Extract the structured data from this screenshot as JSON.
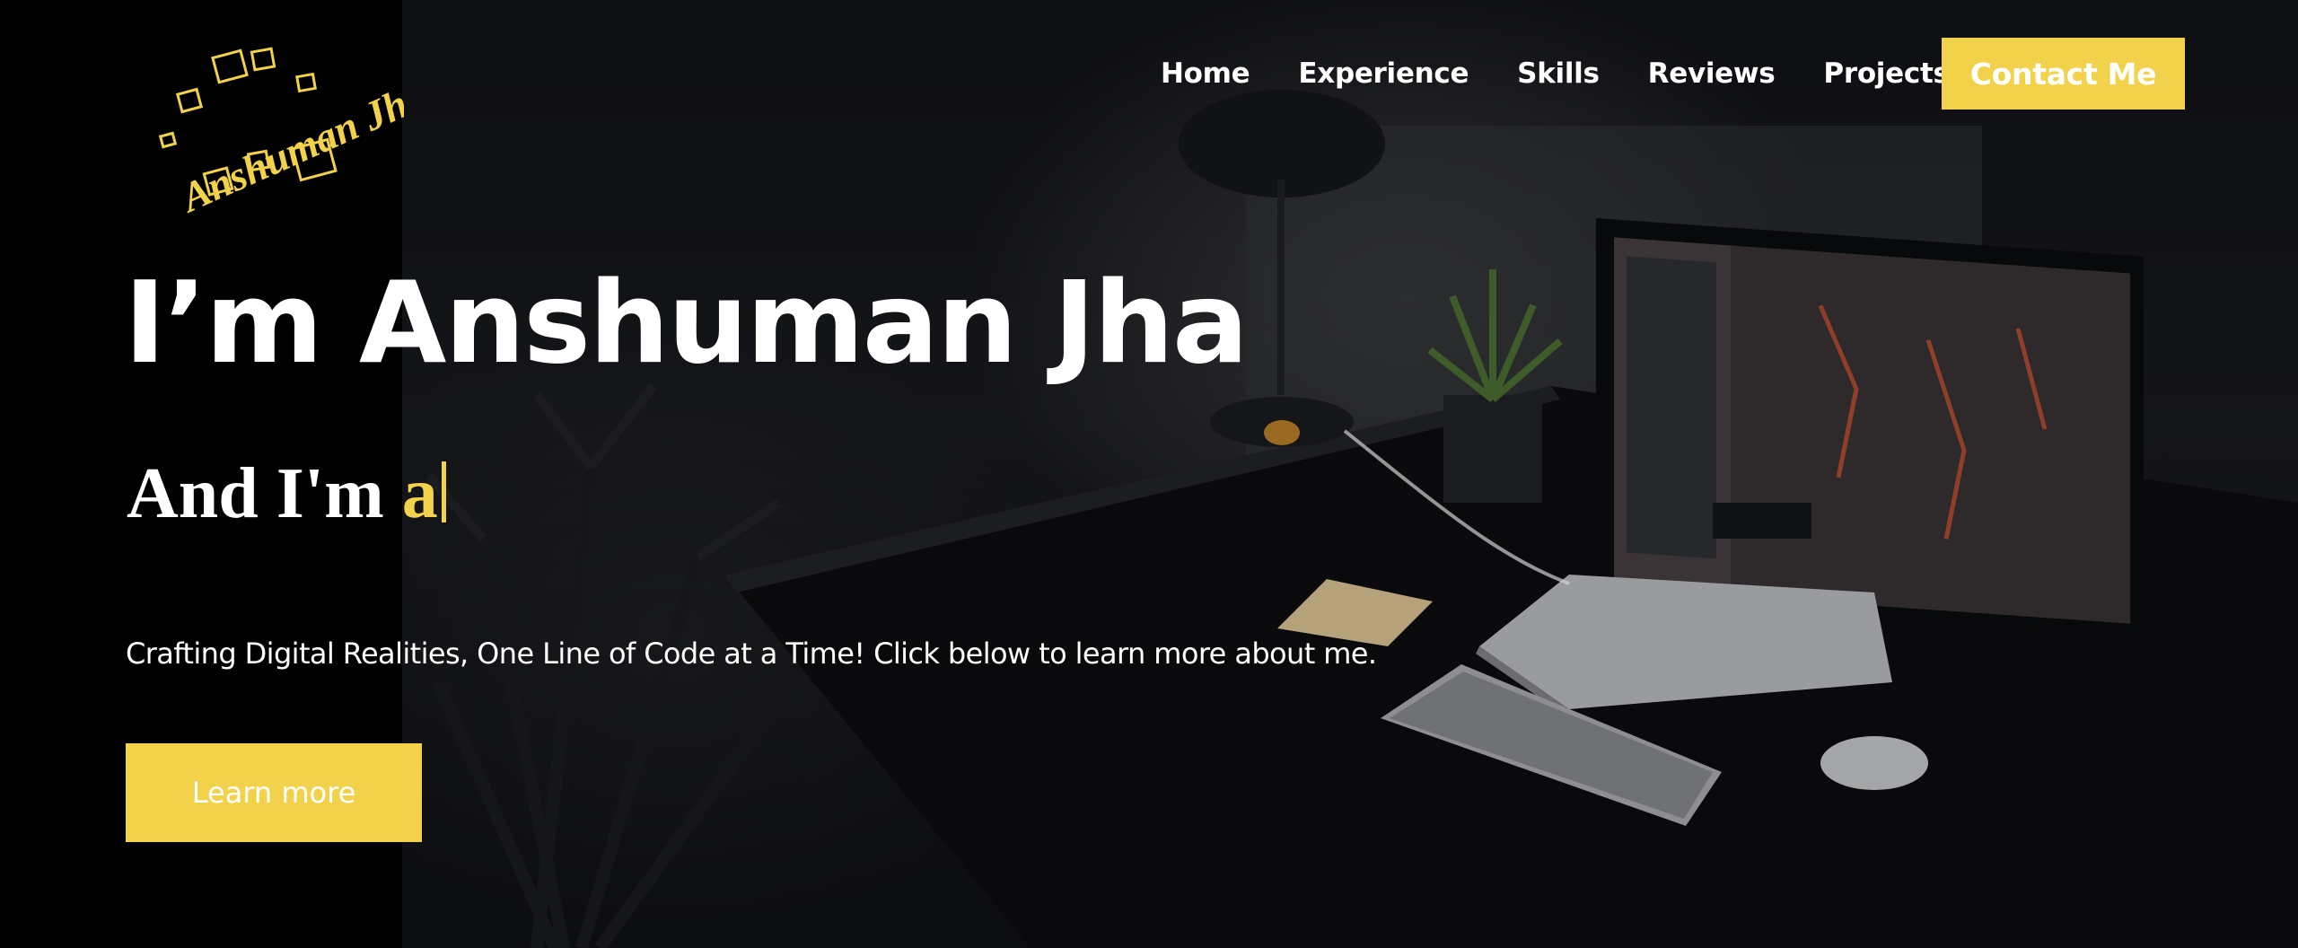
{
  "logo": {
    "text": "Anshuman Jha"
  },
  "nav": {
    "items": [
      {
        "label": "Home"
      },
      {
        "label": "Experience"
      },
      {
        "label": "Skills"
      },
      {
        "label": "Reviews"
      },
      {
        "label": "Projects"
      }
    ],
    "contact_label": "Contact Me"
  },
  "hero": {
    "headline": "I’m Anshuman Jha",
    "subhead_prefix": "And I'm ",
    "typed_text": "a",
    "tagline": "Crafting Digital Realities, One Line of Code at a Time! Click below to learn more about me.",
    "cta_label": "Learn more"
  },
  "colors": {
    "accent": "#f2d24b",
    "text": "#ffffff",
    "background": "#000000"
  }
}
